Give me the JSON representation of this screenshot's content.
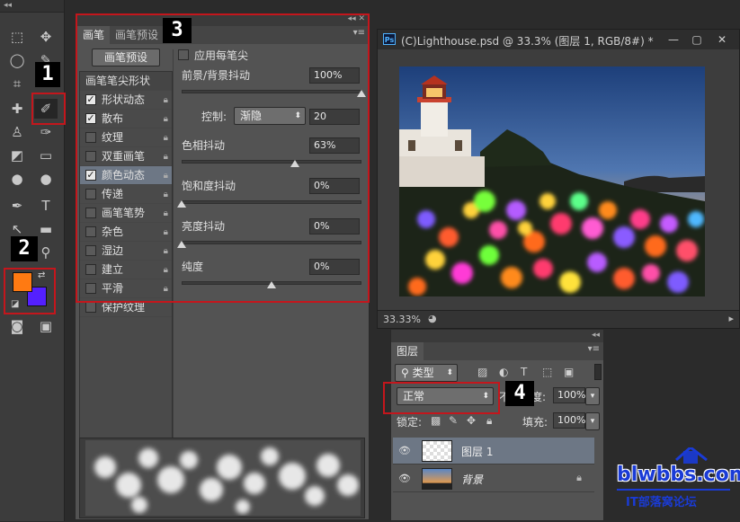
{
  "brush_panel": {
    "tabs": [
      "画笔",
      "画笔预设"
    ],
    "preset_button": "画笔预设",
    "list_header": "画笔笔尖形状",
    "items": [
      {
        "label": "形状动态",
        "checked": true
      },
      {
        "label": "散布",
        "checked": true
      },
      {
        "label": "纹理",
        "checked": false
      },
      {
        "label": "双重画笔",
        "checked": false
      },
      {
        "label": "颜色动态",
        "checked": true
      },
      {
        "label": "传递",
        "checked": false
      },
      {
        "label": "画笔笔势",
        "checked": false
      },
      {
        "label": "杂色",
        "checked": false
      },
      {
        "label": "湿边",
        "checked": false
      },
      {
        "label": "建立",
        "checked": false
      },
      {
        "label": "平滑",
        "checked": false
      },
      {
        "label": "保护纹理",
        "checked": false
      }
    ],
    "apply_per_tip": "应用每笔尖",
    "fg_bg_jitter_label": "前景/背景抖动",
    "fg_bg_jitter_value": "100%",
    "control_label": "控制:",
    "control_value": "渐隐",
    "control_amount": "20",
    "hue_jitter_label": "色相抖动",
    "hue_jitter_value": "63%",
    "sat_jitter_label": "饱和度抖动",
    "sat_jitter_value": "0%",
    "bright_jitter_label": "亮度抖动",
    "bright_jitter_value": "0%",
    "purity_label": "纯度",
    "purity_value": "0%",
    "slider_levels": {
      "fg_bg_jitter": 1.0,
      "hue_jitter": 0.63,
      "sat_jitter": 0.0,
      "bright_jitter": 0.0,
      "purity": 0.5
    }
  },
  "document": {
    "title": "(C)Lighthouse.psd @ 33.3% (图层 1, RGB/8#) *",
    "ps_badge": "Ps",
    "zoom": "33.33%"
  },
  "layers_panel": {
    "title": "图层",
    "filter_kind": "类型",
    "blend_mode": "正常",
    "opacity_label": "不透明度:",
    "opacity_value": "100%",
    "lock_label": "锁定:",
    "fill_label": "填充:",
    "fill_value": "100%",
    "layers": [
      {
        "name": "图层 1",
        "selected": true
      },
      {
        "name": "背景",
        "selected": false
      }
    ]
  },
  "annotations": [
    "1",
    "2",
    "3",
    "4"
  ],
  "watermark": {
    "brand": "blwbbs.com",
    "tagline": "IT部落窝论坛"
  },
  "colors": {
    "foreground": "#ff7a12",
    "background": "#5420ff",
    "annotation_red": "#c4161c",
    "brand_blue": "#1a3bd6"
  }
}
